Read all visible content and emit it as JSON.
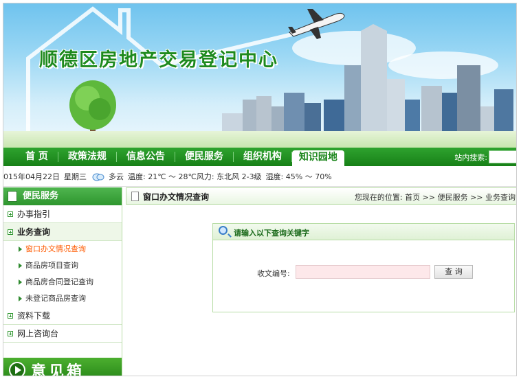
{
  "header": {
    "site_title": "顺德区房地产交易登记中心"
  },
  "nav": {
    "items": [
      {
        "label": "首 页"
      },
      {
        "label": "政策法规"
      },
      {
        "label": "信息公告"
      },
      {
        "label": "便民服务"
      },
      {
        "label": "组织机构"
      },
      {
        "label": "知识园地"
      }
    ],
    "active_index": 5,
    "search_label": "站内搜索:"
  },
  "weather": {
    "date": "015年04月22日",
    "weekday": "星期三",
    "condition": "多云",
    "temperature": "温度: 21℃ ～ 28℃风力: 东北风 2-3级",
    "humidity": "湿度: 45% ～ 70%"
  },
  "sidebar": {
    "title": "便民服务",
    "categories": [
      {
        "label": "办事指引"
      },
      {
        "label": "业务查询"
      },
      {
        "label": "资料下载"
      },
      {
        "label": "网上咨询台"
      }
    ],
    "subitems": [
      {
        "label": "窗口办文情况查询"
      },
      {
        "label": "商品房项目查询"
      },
      {
        "label": "商品房合同登记查询"
      },
      {
        "label": "未登记商品房查询"
      }
    ],
    "banner_text": "意见箱"
  },
  "main": {
    "title": "窗口办文情况查询",
    "breadcrumb": "您现在的位置: 首页 >> 便民服务 >> 业务查询",
    "query": {
      "heading": "请输入以下查询关键字",
      "field_label": "收文编号:",
      "field_value": "",
      "button_label": "查 询"
    }
  },
  "colors": {
    "brand_green": "#2e962e",
    "highlight_orange": "#ff5a00",
    "input_pink": "#fde8ea"
  }
}
